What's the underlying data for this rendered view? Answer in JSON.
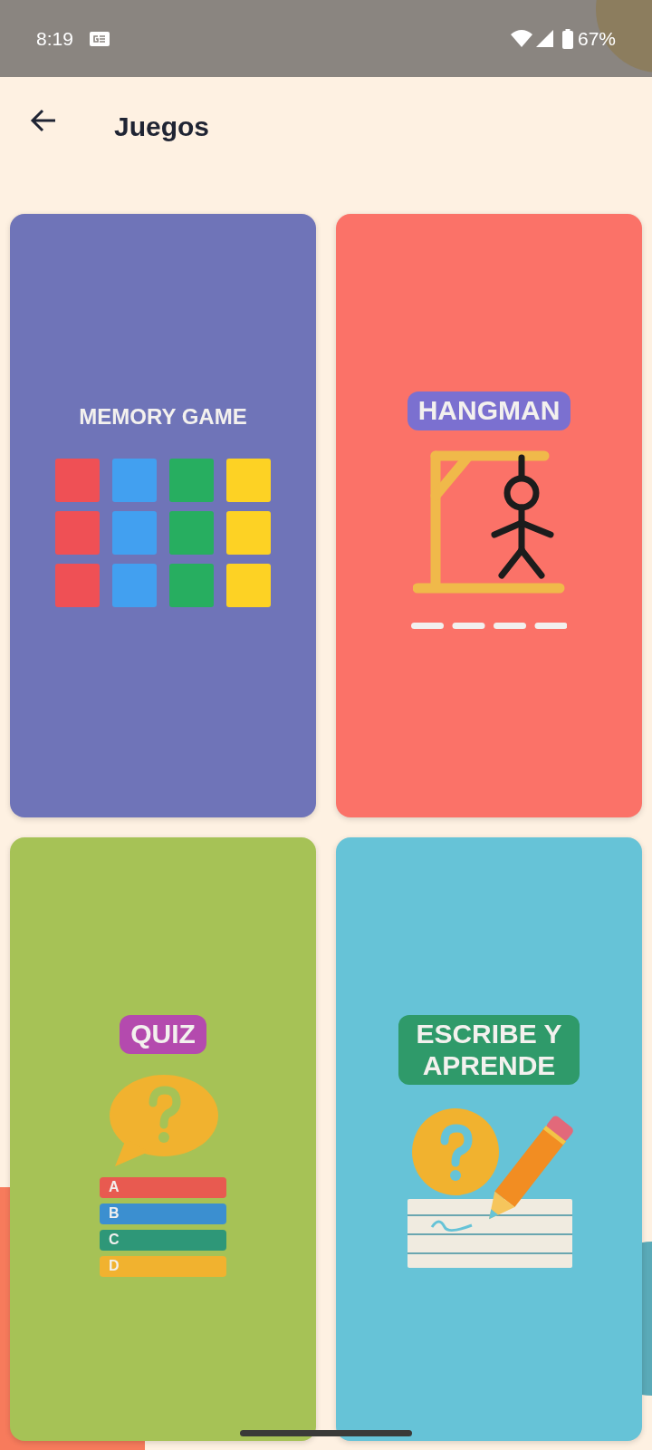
{
  "status_bar": {
    "time": "8:19",
    "battery": "67%"
  },
  "header": {
    "title": "Juegos"
  },
  "games": [
    {
      "kind": "memory",
      "title": "MEMORY GAME",
      "color": "#6f74b8"
    },
    {
      "kind": "hangman",
      "title": "HANGMAN",
      "color": "#fb7268"
    },
    {
      "kind": "quiz",
      "title": "QUIZ",
      "color": "#a6c256",
      "options": [
        {
          "label": "A",
          "color": "#e85a50"
        },
        {
          "label": "B",
          "color": "#3b8fd0"
        },
        {
          "label": "C",
          "color": "#2e9778"
        },
        {
          "label": "D",
          "color": "#f1b22f"
        }
      ]
    },
    {
      "kind": "write",
      "title": "ESCRIBE Y APRENDE",
      "color": "#66c3d7"
    }
  ]
}
